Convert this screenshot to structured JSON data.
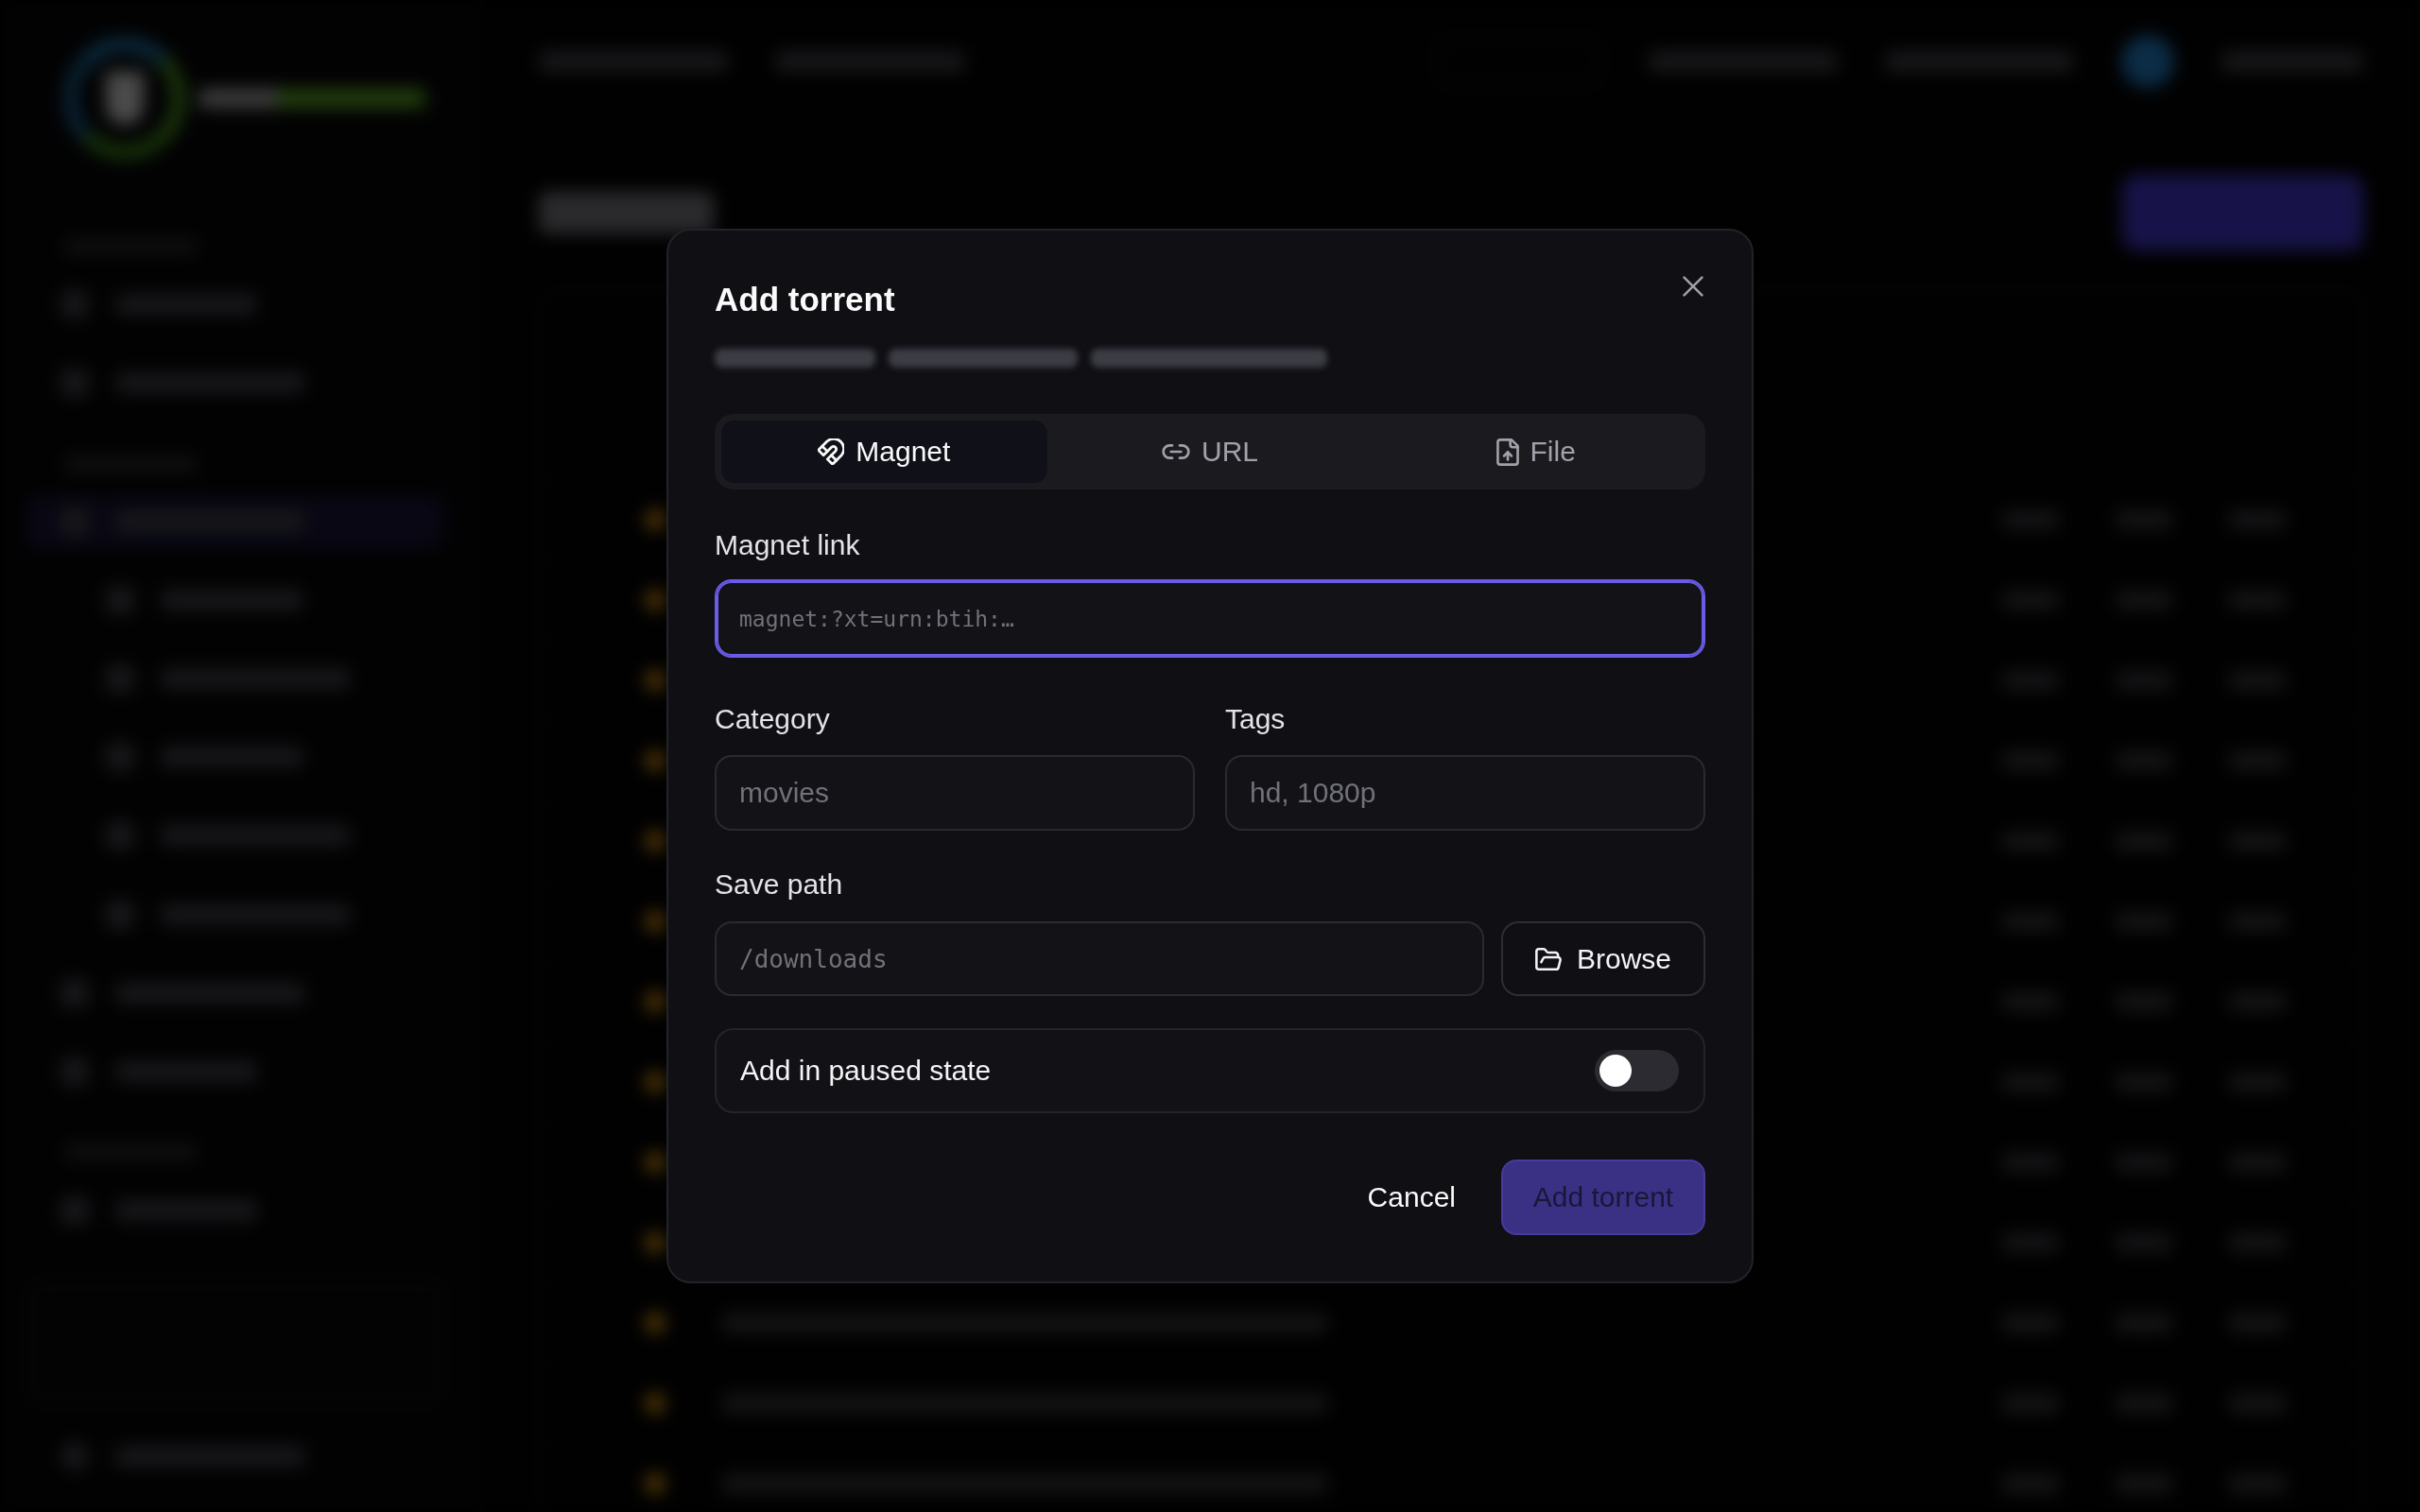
{
  "dialog": {
    "title": "Add torrent"
  },
  "tabs": [
    {
      "kind": "magnet",
      "label": "Magnet",
      "selected": true
    },
    {
      "kind": "link",
      "label": "URL",
      "selected": false
    },
    {
      "kind": "file",
      "label": "File",
      "selected": false
    }
  ],
  "magnet_link": {
    "label": "Magnet link",
    "placeholder": "magnet:?xt=urn:btih:…",
    "focused": true
  },
  "category": {
    "label": "Category",
    "placeholder": "movies"
  },
  "tags": {
    "label": "Tags",
    "placeholder": "hd, 1080p"
  },
  "save_path": {
    "label": "Save path",
    "placeholder": "/downloads",
    "browse_button": "Browse"
  },
  "paused_toggle": {
    "label": "Add in paused state",
    "on": false
  },
  "actions": {
    "cancel": "Cancel",
    "submit": {
      "label": "Add torrent",
      "disabled": true
    }
  }
}
